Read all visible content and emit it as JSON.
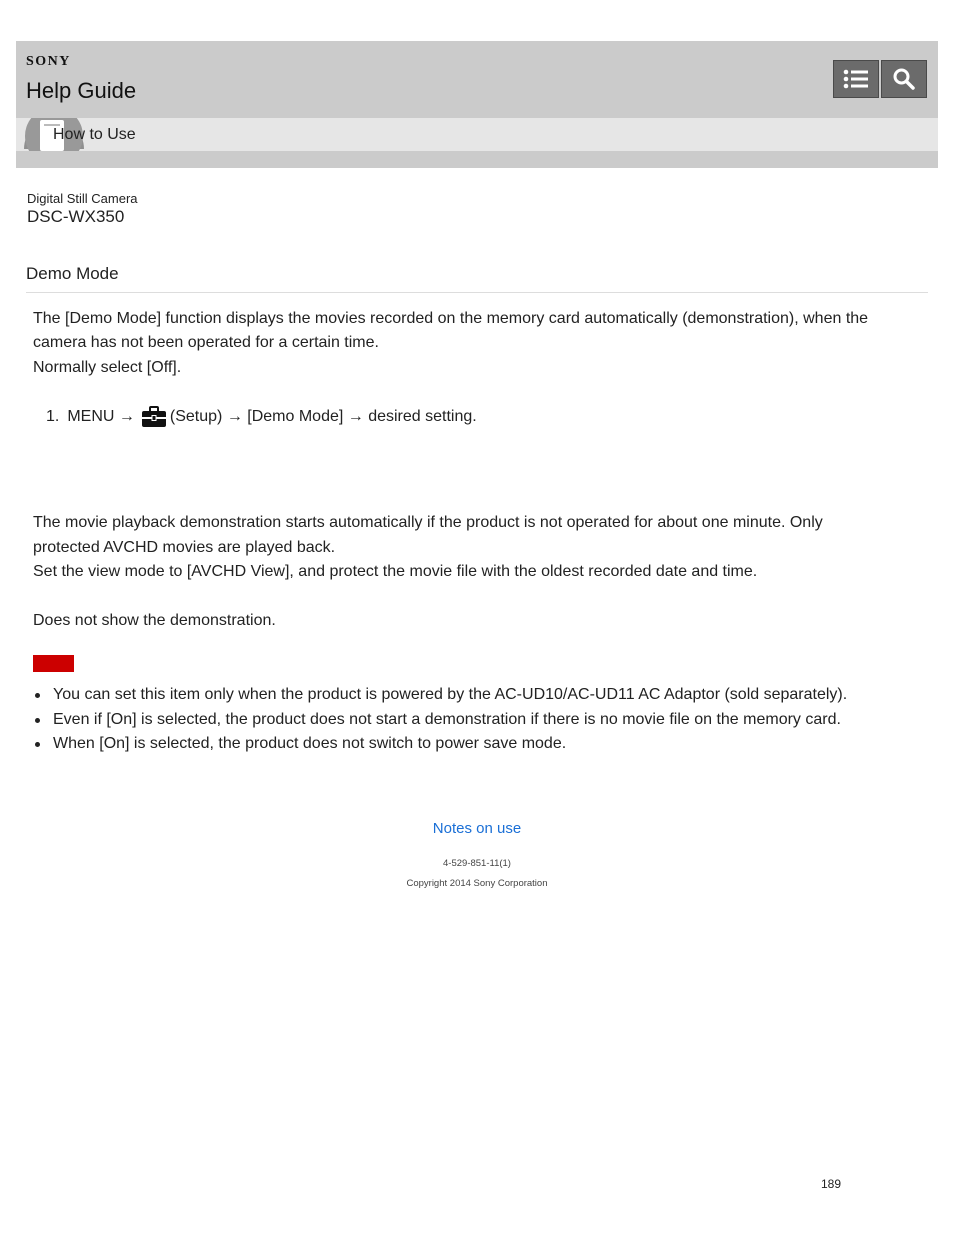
{
  "header": {
    "brand": "SONY",
    "title": "Help Guide",
    "list_icon": "list-icon",
    "search_icon": "search-icon"
  },
  "breadcrumb": {
    "label": "How to Use",
    "icon": "book-icon"
  },
  "product": {
    "type": "Digital Still Camera",
    "model": "DSC-WX350"
  },
  "page_title": "Demo Mode",
  "intro": [
    "The [Demo Mode] function displays the movies recorded on the memory card automatically (demonstration), when the",
    "camera has not been operated for a certain time.",
    "Normally select [Off]."
  ],
  "step": {
    "number": "1.",
    "before_icon": "MENU →",
    "icon": "toolbox-icon",
    "after_icon": "(Setup) → [Demo Mode] → desired setting."
  },
  "on_description": [
    "The movie playback demonstration starts automatically if the product is not operated for about one minute. Only",
    "protected AVCHD movies are played back.",
    "Set the view mode to [AVCHD View], and protect the movie file with the oldest recorded date and time."
  ],
  "off_description": "Does not show the demonstration.",
  "note_color": "#cc0000",
  "notes": [
    "You can set this item only when the product is powered by the AC-UD10/AC-UD11 AC Adaptor (sold separately).",
    "Even if [On] is selected, the product does not start a demonstration if there is no movie file on the memory card.",
    "When [On] is selected, the product does not switch to power save mode."
  ],
  "related_link": "Notes on use",
  "doc_code": "4-529-851-11(1)",
  "copyright": "Copyright 2014 Sony Corporation",
  "page_number": "189",
  "colors": {
    "header_bg": "#cbcbcb",
    "subbar_bg": "#e6e6e6",
    "link": "#1a6fd6"
  }
}
